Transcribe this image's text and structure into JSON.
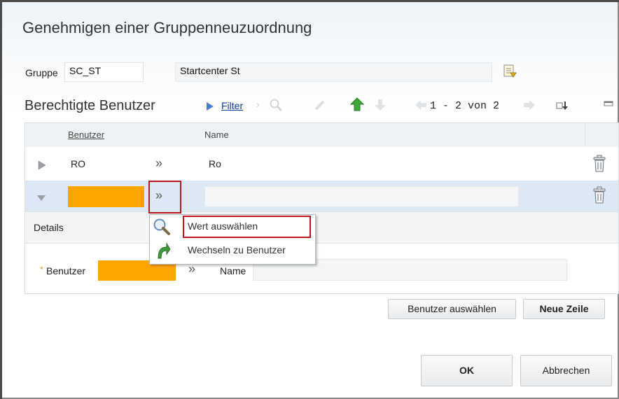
{
  "dialog": {
    "title": "Genehmigen einer Gruppenneuzuordnung"
  },
  "group": {
    "label": "Gruppe",
    "value": "SC_ST",
    "description": "Startcenter St"
  },
  "section": {
    "title": "Berechtigte Benutzer",
    "filter_label": "Filter",
    "pager_text": "1 - 2 von 2"
  },
  "table": {
    "columns": [
      "Benutzer",
      "Name"
    ],
    "rows": [
      {
        "user": "RO",
        "name": "Ro"
      },
      {
        "user": "",
        "name": ""
      }
    ]
  },
  "details": {
    "title": "Details",
    "user_label": "Benutzer",
    "name_label": "Name",
    "required_marker": "*"
  },
  "popup": {
    "items": [
      "Wert auswählen",
      "Wechseln zu Benutzer"
    ]
  },
  "buttons": {
    "select_users": "Benutzer auswählen",
    "new_row": "Neue Zeile",
    "ok": "OK",
    "cancel": "Abbrechen"
  },
  "colors": {
    "highlight": "#ffa500",
    "selected_row": "#dce9f4",
    "red_outline": "#c0141c",
    "link": "#0a3c9c"
  }
}
